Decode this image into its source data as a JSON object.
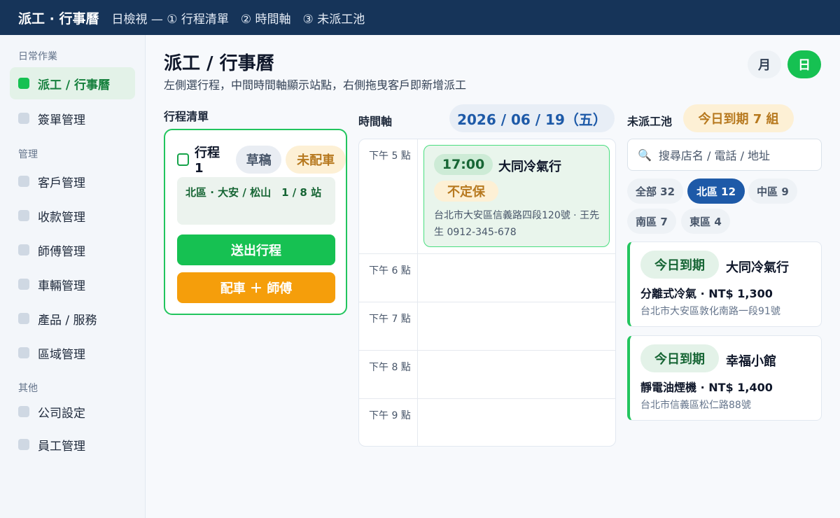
{
  "topbar": {
    "brand": "派工 · 行事曆",
    "subtitle": "日檢視 — ① 行程清單　② 時間軸　③ 未派工池"
  },
  "sidebar": {
    "sections": [
      "日常作業",
      "管理",
      "其他"
    ],
    "items": [
      {
        "label": "派工 / 行事曆",
        "active": true
      },
      {
        "label": "簽單管理"
      },
      {
        "label": "客戶管理"
      },
      {
        "label": "收款管理"
      },
      {
        "label": "師傅管理"
      },
      {
        "label": "車輛管理"
      },
      {
        "label": "產品 / 服務"
      },
      {
        "label": "區域管理"
      },
      {
        "label": "公司設定"
      },
      {
        "label": "員工管理"
      }
    ]
  },
  "header": {
    "title": "派工 / 行事曆",
    "description": "左側選行程，中間時間軸顯示站點，右側拖曳客戶即新增派工",
    "view_month": "月",
    "view_day": "日"
  },
  "trips": {
    "label": "行程清單",
    "trip": {
      "name": "行程 1",
      "status_draft": "草稿",
      "status_vehicle": "未配車",
      "area": "北區 · 大安 / 松山　1 / 8 站",
      "send_label": "送出行程",
      "assign_label": "配車 ＋ 師傅"
    }
  },
  "timeline": {
    "label": "時間軸",
    "date": "2026 / 06 / 19（五）",
    "hours": [
      "下午 5 點",
      "下午 6 點",
      "下午 7 點",
      "下午 8 點",
      "下午 9 點"
    ],
    "event": {
      "time": "17:00",
      "customer": "大同冷氣行",
      "tag": "不定保",
      "address": "台北市大安區信義路四段120號 · 王先生 0912-345-678"
    }
  },
  "pool": {
    "label": "未派工池",
    "due_badge": "今日到期 7 組",
    "search_placeholder": "搜尋店名 / 電話 / 地址",
    "regions": [
      {
        "label": "全部 32"
      },
      {
        "label": "北區 12",
        "active": true
      },
      {
        "label": "中區 9"
      },
      {
        "label": "南區 7"
      },
      {
        "label": "東區 4"
      }
    ],
    "customers": [
      {
        "due": "今日到期",
        "name": "大同冷氣行",
        "service": "分離式冷氣 · NT$ 1,300",
        "address": "台北市大安區敦化南路一段91號"
      },
      {
        "due": "今日到期",
        "name": "幸福小館",
        "service": "靜電油煙機 · NT$ 1,400",
        "address": "台北市信義區松仁路88號"
      }
    ]
  },
  "colors": {
    "topbar": "#163459",
    "accent_green": "#16c152",
    "accent_orange": "#f59e0b",
    "accent_blue": "#1e5aa8"
  }
}
